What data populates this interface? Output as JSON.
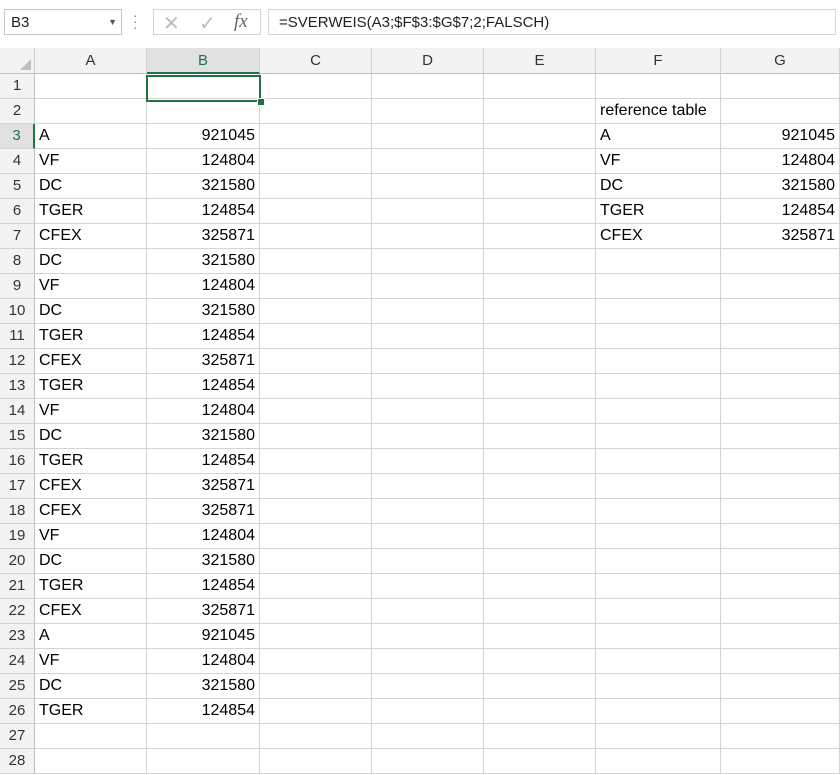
{
  "name_box": {
    "value": "B3"
  },
  "formula_bar": {
    "formula": "=SVERWEIS(A3;$F$3:$G$7;2;FALSCH)",
    "fx_label": "fx"
  },
  "columns": [
    "A",
    "B",
    "C",
    "D",
    "E",
    "F",
    "G"
  ],
  "selected_column": "B",
  "selected_row": 3,
  "active_cell": "B3",
  "rows": [
    {
      "row": 1,
      "A": "",
      "B": "",
      "F": "",
      "G": ""
    },
    {
      "row": 2,
      "A": "",
      "B": "",
      "F": "reference table",
      "G": ""
    },
    {
      "row": 3,
      "A": "A",
      "B": "921045",
      "F": "A",
      "G": "921045"
    },
    {
      "row": 4,
      "A": "VF",
      "B": "124804",
      "F": "VF",
      "G": "124804"
    },
    {
      "row": 5,
      "A": "DC",
      "B": "321580",
      "F": "DC",
      "G": "321580"
    },
    {
      "row": 6,
      "A": "TGER",
      "B": "124854",
      "F": "TGER",
      "G": "124854"
    },
    {
      "row": 7,
      "A": "CFEX",
      "B": "325871",
      "F": "CFEX",
      "G": "325871"
    },
    {
      "row": 8,
      "A": "DC",
      "B": "321580",
      "F": "",
      "G": ""
    },
    {
      "row": 9,
      "A": "VF",
      "B": "124804",
      "F": "",
      "G": ""
    },
    {
      "row": 10,
      "A": "DC",
      "B": "321580",
      "F": "",
      "G": ""
    },
    {
      "row": 11,
      "A": "TGER",
      "B": "124854",
      "F": "",
      "G": ""
    },
    {
      "row": 12,
      "A": "CFEX",
      "B": "325871",
      "F": "",
      "G": ""
    },
    {
      "row": 13,
      "A": "TGER",
      "B": "124854",
      "F": "",
      "G": ""
    },
    {
      "row": 14,
      "A": "VF",
      "B": "124804",
      "F": "",
      "G": ""
    },
    {
      "row": 15,
      "A": "DC",
      "B": "321580",
      "F": "",
      "G": ""
    },
    {
      "row": 16,
      "A": "TGER",
      "B": "124854",
      "F": "",
      "G": ""
    },
    {
      "row": 17,
      "A": "CFEX",
      "B": "325871",
      "F": "",
      "G": ""
    },
    {
      "row": 18,
      "A": "CFEX",
      "B": "325871",
      "F": "",
      "G": ""
    },
    {
      "row": 19,
      "A": "VF",
      "B": "124804",
      "F": "",
      "G": ""
    },
    {
      "row": 20,
      "A": "DC",
      "B": "321580",
      "F": "",
      "G": ""
    },
    {
      "row": 21,
      "A": "TGER",
      "B": "124854",
      "F": "",
      "G": ""
    },
    {
      "row": 22,
      "A": "CFEX",
      "B": "325871",
      "F": "",
      "G": ""
    },
    {
      "row": 23,
      "A": "A",
      "B": "921045",
      "F": "",
      "G": ""
    },
    {
      "row": 24,
      "A": "VF",
      "B": "124804",
      "F": "",
      "G": ""
    },
    {
      "row": 25,
      "A": "DC",
      "B": "321580",
      "F": "",
      "G": ""
    },
    {
      "row": 26,
      "A": "TGER",
      "B": "124854",
      "F": "",
      "G": ""
    },
    {
      "row": 27,
      "A": "",
      "B": "",
      "F": "",
      "G": ""
    },
    {
      "row": 28,
      "A": "",
      "B": "",
      "F": "",
      "G": ""
    }
  ],
  "colors": {
    "accent": "#217346",
    "header_bg": "#f3f3f3",
    "gridline": "#d4d4d4"
  }
}
